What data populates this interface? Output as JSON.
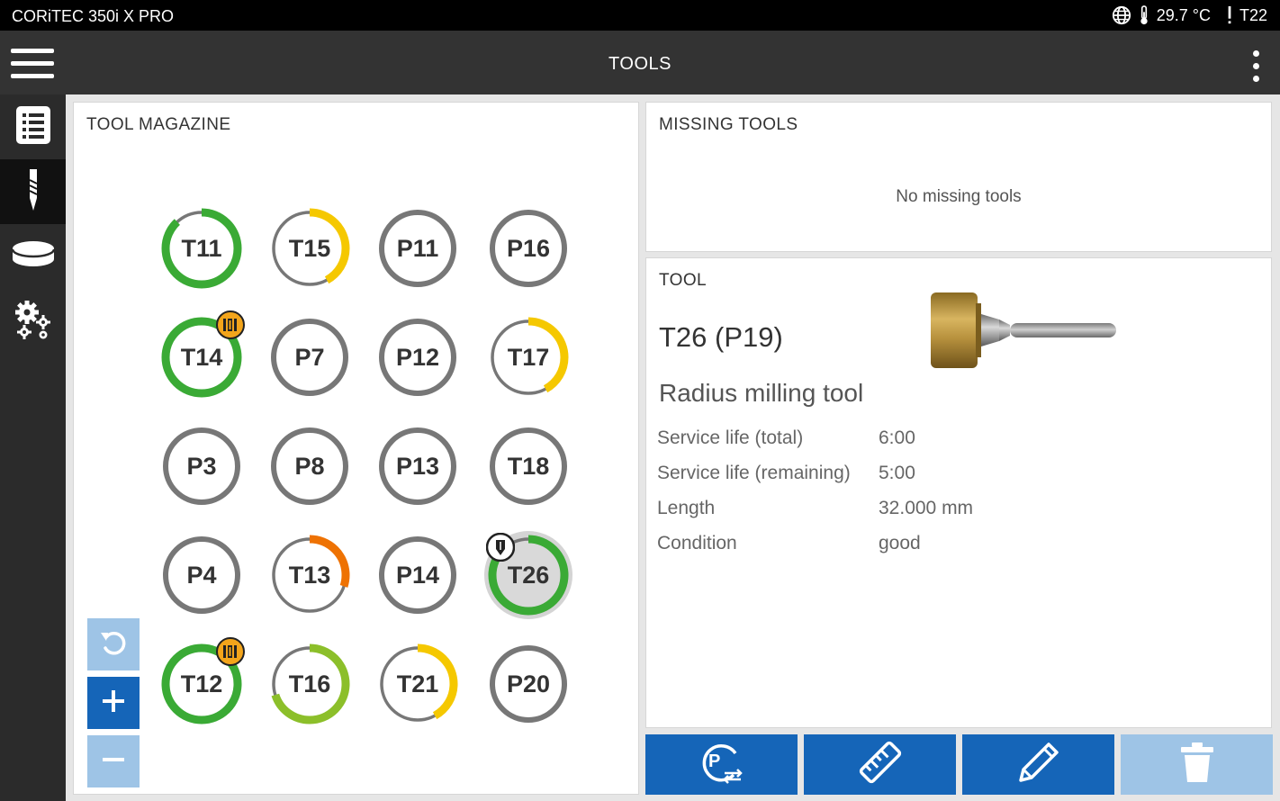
{
  "status": {
    "device": "CORiTEC 350i X PRO",
    "temperature": "29.7 °C",
    "active_tool": "T22"
  },
  "header": {
    "title": "TOOLS"
  },
  "nav": {
    "items": [
      "list-icon",
      "tool-icon",
      "blank-disc-icon",
      "settings-icon"
    ],
    "active": "tool-icon"
  },
  "magazine": {
    "title": "TOOL MAGAZINE",
    "slots": [
      {
        "label": "T11",
        "remaining": 0.88,
        "color": "#3aaa35",
        "badge": "",
        "selected": false
      },
      {
        "label": "T15",
        "remaining": 0.42,
        "color": "#f5c800",
        "badge": "",
        "selected": false
      },
      {
        "label": "P11",
        "remaining": 0,
        "color": "",
        "badge": "",
        "selected": false
      },
      {
        "label": "P16",
        "remaining": 0,
        "color": "",
        "badge": "",
        "selected": false
      },
      {
        "label": "T14",
        "remaining": 1.0,
        "color": "#3aaa35",
        "badge": "warning-tool-icon",
        "selected": false
      },
      {
        "label": "P7",
        "remaining": 0,
        "color": "",
        "badge": "",
        "selected": false
      },
      {
        "label": "P12",
        "remaining": 0,
        "color": "",
        "badge": "",
        "selected": false
      },
      {
        "label": "T17",
        "remaining": 0.42,
        "color": "#f5c800",
        "badge": "",
        "selected": false
      },
      {
        "label": "P3",
        "remaining": 0,
        "color": "",
        "badge": "",
        "selected": false
      },
      {
        "label": "P8",
        "remaining": 0,
        "color": "",
        "badge": "",
        "selected": false
      },
      {
        "label": "P13",
        "remaining": 0,
        "color": "",
        "badge": "",
        "selected": false
      },
      {
        "label": "T18",
        "remaining": 0,
        "color": "",
        "badge": "",
        "selected": false
      },
      {
        "label": "P4",
        "remaining": 0,
        "color": "",
        "badge": "",
        "selected": false
      },
      {
        "label": "T13",
        "remaining": 0.3,
        "color": "#ee7203",
        "badge": "",
        "selected": false
      },
      {
        "label": "P14",
        "remaining": 0,
        "color": "",
        "badge": "",
        "selected": false
      },
      {
        "label": "T26",
        "remaining": 0.83,
        "color": "#3aaa35",
        "badge": "in-spindle-icon",
        "selected": true
      },
      {
        "label": "T12",
        "remaining": 1.0,
        "color": "#3aaa35",
        "badge": "warning-tool-icon",
        "selected": false
      },
      {
        "label": "T16",
        "remaining": 0.7,
        "color": "#8cbf2a",
        "badge": "",
        "selected": false
      },
      {
        "label": "T21",
        "remaining": 0.42,
        "color": "#f5c800",
        "badge": "",
        "selected": false
      },
      {
        "label": "P20",
        "remaining": 0,
        "color": "",
        "badge": "",
        "selected": false
      }
    ]
  },
  "zoom": {
    "reset_icon": "reset-zoom-icon",
    "zoom_in_icon": "plus-icon",
    "zoom_out_icon": "minus-icon"
  },
  "missing_tools": {
    "title": "MISSING TOOLS",
    "empty_text": "No missing tools"
  },
  "tool": {
    "title": "TOOL",
    "id": "T26 (P19)",
    "type": "Radius milling tool",
    "properties": [
      {
        "label": "Service life (total)",
        "value": "6:00"
      },
      {
        "label": "Service life (remaining)",
        "value": "5:00"
      },
      {
        "label": "Length",
        "value": "32.000 mm"
      },
      {
        "label": "Condition",
        "value": "good"
      }
    ]
  },
  "actions": [
    {
      "icon": "change-position-icon",
      "enabled": true
    },
    {
      "icon": "measure-icon",
      "enabled": true
    },
    {
      "icon": "edit-icon",
      "enabled": true
    },
    {
      "icon": "delete-icon",
      "enabled": false
    }
  ],
  "colors": {
    "accent": "#1565b8",
    "accent_disabled": "#9ec4e6",
    "ring_empty": "#777777",
    "ok": "#3aaa35",
    "warn": "#f5c800",
    "critical": "#ee7203"
  }
}
